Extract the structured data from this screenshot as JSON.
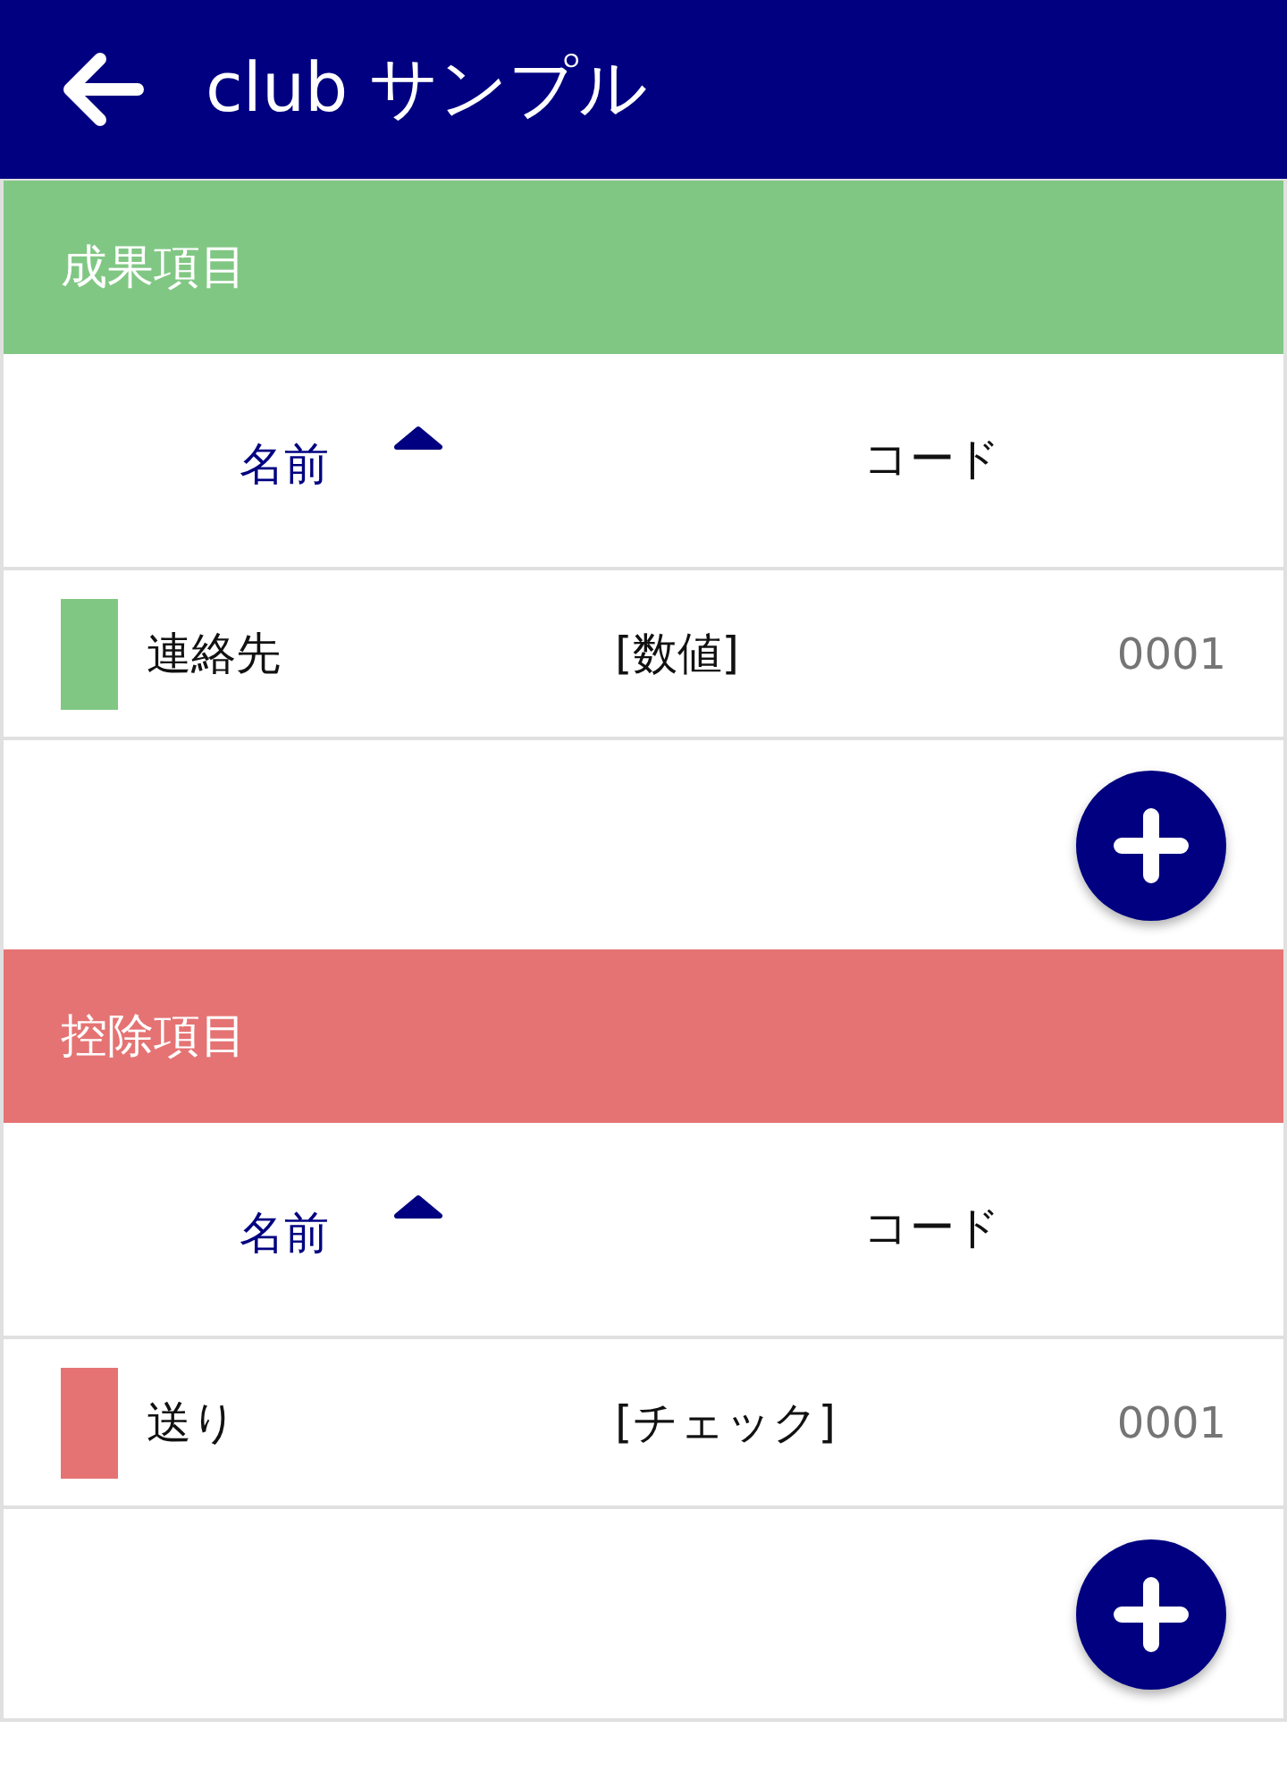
{
  "app_bar": {
    "title": "club サンプル"
  },
  "sections": [
    {
      "title": "成果項目",
      "color": "#81c784",
      "columns": [
        {
          "label": "名前",
          "sorted": true
        },
        {
          "label": "コード",
          "sorted": false
        }
      ],
      "rows": [
        {
          "name": "連絡先",
          "type": "[数値]",
          "code": "0001",
          "color": "#81c784"
        }
      ]
    },
    {
      "title": "控除項目",
      "color": "#e57373",
      "columns": [
        {
          "label": "名前",
          "sorted": true
        },
        {
          "label": "コード",
          "sorted": false
        }
      ],
      "rows": [
        {
          "name": "送り",
          "type": "[チェック]",
          "code": "0001",
          "color": "#e57373"
        }
      ]
    }
  ]
}
